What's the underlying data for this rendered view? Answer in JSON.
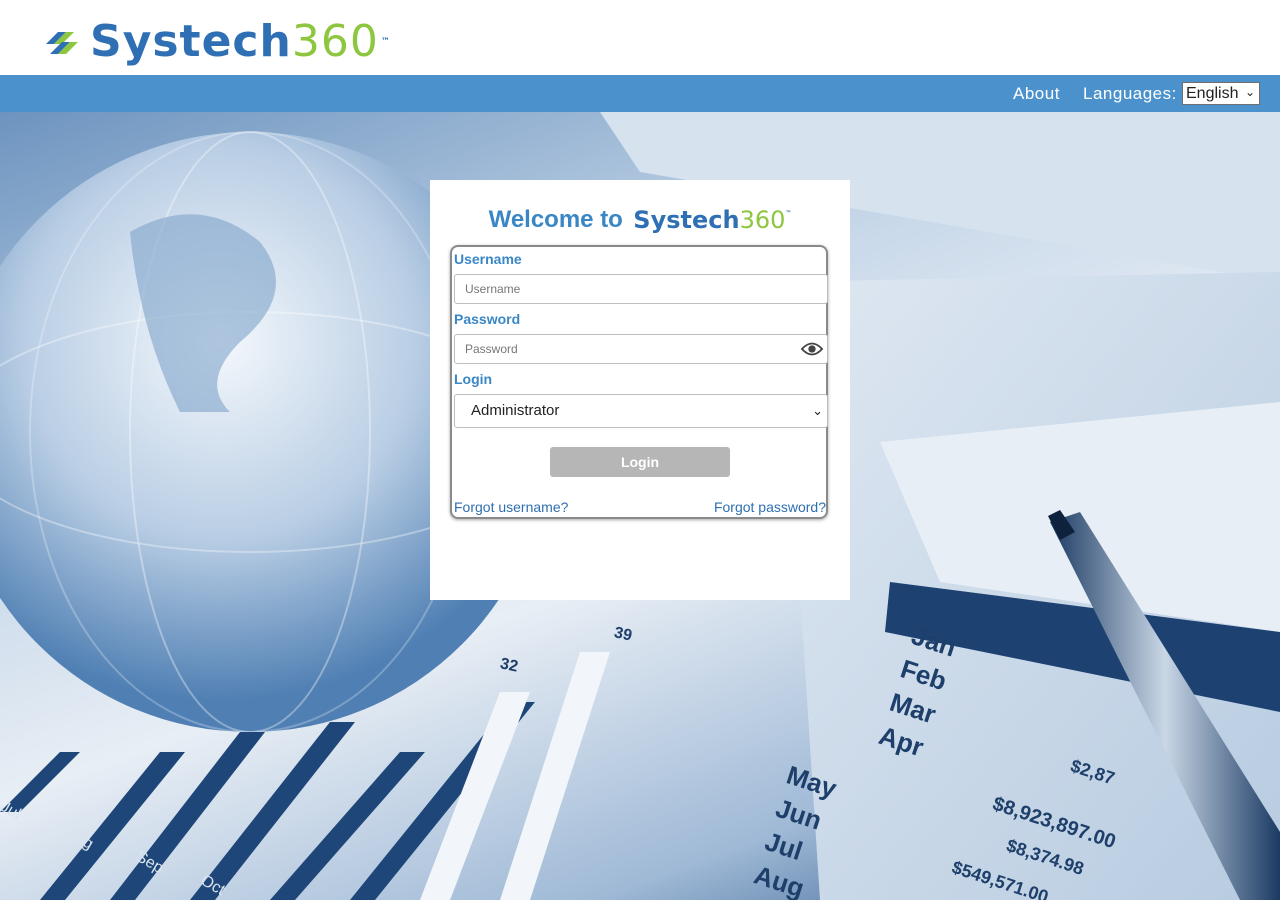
{
  "header": {
    "logo": {
      "brand_main": "Systech",
      "brand_num": "360",
      "trademark": "™"
    }
  },
  "nav": {
    "about_label": "About",
    "languages_label": "Languages:",
    "language_selected": "English"
  },
  "login_panel": {
    "welcome_text": "Welcome to",
    "brand_main": "Systech",
    "brand_num": "360",
    "trademark": "™",
    "username_label": "Username",
    "username_placeholder": "Username",
    "password_label": "Password",
    "password_placeholder": "Password",
    "login_type_label": "Login",
    "login_type_selected": "Administrator",
    "login_button": "Login",
    "forgot_username": "Forgot username?",
    "forgot_password": "Forgot password?"
  },
  "background_text": {
    "months": [
      "Jan",
      "Feb",
      "Mar",
      "Apr",
      "May",
      "Jun",
      "Jul",
      "Aug"
    ],
    "bottom_months": [
      "Jul",
      "Aug",
      "Sep",
      "Oct"
    ],
    "bar_values": [
      "32",
      "39"
    ],
    "amounts": [
      "$8,923,897.00",
      "$8,374.98",
      "$549,571.00",
      "$2,87"
    ]
  },
  "colors": {
    "nav_bg": "#4b92cc",
    "brand_blue": "#2f6fb3",
    "brand_green": "#8dc63f",
    "label_blue": "#3a87c6",
    "button_disabled": "#b6b6b6"
  }
}
